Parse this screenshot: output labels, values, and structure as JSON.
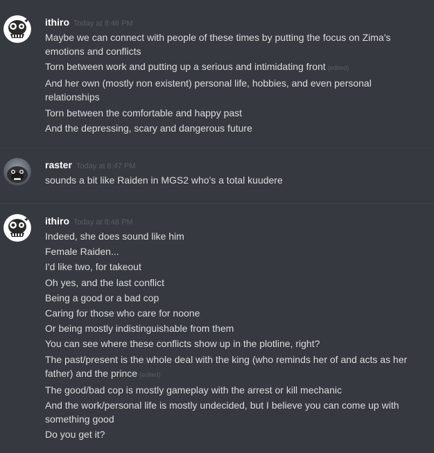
{
  "groups": [
    {
      "username": "ithiro",
      "timestamp": "Today at 8:46 PM",
      "avatar_icon": "skull-avatar-icon",
      "messages": [
        {
          "text": "Maybe we can connect with people of these times by putting the focus on Zima's emotions and conflicts",
          "edited": ""
        },
        {
          "text": "Torn between work and putting up a serious and intimidating front",
          "edited": "(edited)"
        },
        {
          "text": "And her own (mostly non existent) personal life, hobbies, and even personal relationships",
          "edited": ""
        },
        {
          "text": "Torn between the comfortable and happy past",
          "edited": ""
        },
        {
          "text": "And the depressing, scary and dangerous future",
          "edited": ""
        }
      ]
    },
    {
      "username": "raster",
      "timestamp": "Today at 8:47 PM",
      "avatar_icon": "dog-photo-avatar-icon",
      "messages": [
        {
          "text": "sounds a bit like Raiden in MGS2 who's a total kuudere",
          "edited": ""
        }
      ]
    },
    {
      "username": "ithiro",
      "timestamp": "Today at 8:48 PM",
      "avatar_icon": "skull-avatar-icon",
      "messages": [
        {
          "text": "Indeed, she does sound like him",
          "edited": ""
        },
        {
          "text": "Female Raiden...",
          "edited": ""
        },
        {
          "text": "I'd like two, for takeout",
          "edited": ""
        },
        {
          "text": "Oh yes, and the last conflict",
          "edited": ""
        },
        {
          "text": "Being a good or a bad cop",
          "edited": ""
        },
        {
          "text": "Caring for those who care for noone",
          "edited": ""
        },
        {
          "text": "Or being mostly indistinguishable from them",
          "edited": ""
        },
        {
          "text": "You can see where these conflicts show up in the plotline, right?",
          "edited": ""
        },
        {
          "text": "The past/present is the whole deal with the king (who reminds her of and acts as her father) and the prince",
          "edited": "(edited)"
        },
        {
          "text": "The good/bad cop is mostly gameplay with the arrest or kill mechanic",
          "edited": ""
        },
        {
          "text": "And the work/personal life is mostly undecided, but I believe you can come up with something good",
          "edited": ""
        },
        {
          "text": "Do you get it?",
          "edited": ""
        }
      ]
    }
  ],
  "colors": {
    "background": "#36393f",
    "username": "#ffffff",
    "message_text": "#dcddde",
    "timestamp": "#5a5d63",
    "divider": "#3f4248"
  }
}
